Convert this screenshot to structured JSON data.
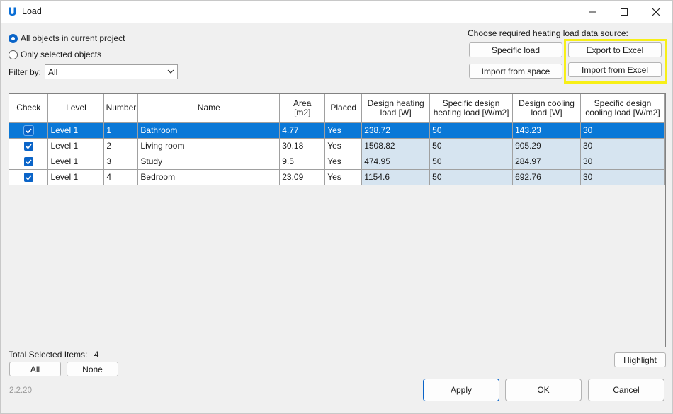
{
  "window": {
    "title": "Load"
  },
  "options": {
    "all_objects": "All objects in current project",
    "selected_objects": "Only selected objects",
    "filter_label": "Filter by:",
    "filter_value": "All"
  },
  "source": {
    "label": "Choose required heating load data source:",
    "specific_load": "Specific load",
    "import_space": "Import from space",
    "export_excel": "Export to Excel",
    "import_excel": "Import from Excel"
  },
  "table": {
    "headers": [
      "Check",
      "Level",
      "Number",
      "Name",
      "Area\n[m2]",
      "Placed",
      "Design heating\nload [W]",
      "Specific design\nheating load [W/m2]",
      "Design cooling\nload [W]",
      "Specific design\ncooling load [W/m2]"
    ],
    "rows": [
      {
        "checked": true,
        "level": "Level 1",
        "number": "1",
        "name": "Bathroom",
        "area": "4.77",
        "placed": "Yes",
        "heat": "238.72",
        "sheat": "50",
        "cool": "143.23",
        "scool": "30"
      },
      {
        "checked": true,
        "level": "Level 1",
        "number": "2",
        "name": "Living room",
        "area": "30.18",
        "placed": "Yes",
        "heat": "1508.82",
        "sheat": "50",
        "cool": "905.29",
        "scool": "30"
      },
      {
        "checked": true,
        "level": "Level 1",
        "number": "3",
        "name": "Study",
        "area": "9.5",
        "placed": "Yes",
        "heat": "474.95",
        "sheat": "50",
        "cool": "284.97",
        "scool": "30"
      },
      {
        "checked": true,
        "level": "Level 1",
        "number": "4",
        "name": "Bedroom",
        "area": "23.09",
        "placed": "Yes",
        "heat": "1154.6",
        "sheat": "50",
        "cool": "692.76",
        "scool": "30"
      }
    ]
  },
  "footer": {
    "total_label": "Total Selected Items:",
    "total_value": "4",
    "all": "All",
    "none": "None",
    "highlight": "Highlight",
    "version": "2.2.20",
    "apply": "Apply",
    "ok": "OK",
    "cancel": "Cancel"
  },
  "colors": {
    "accent": "#0a78d7",
    "editable_cell": "#d6e4f0",
    "annotation": "#f7ef17"
  }
}
